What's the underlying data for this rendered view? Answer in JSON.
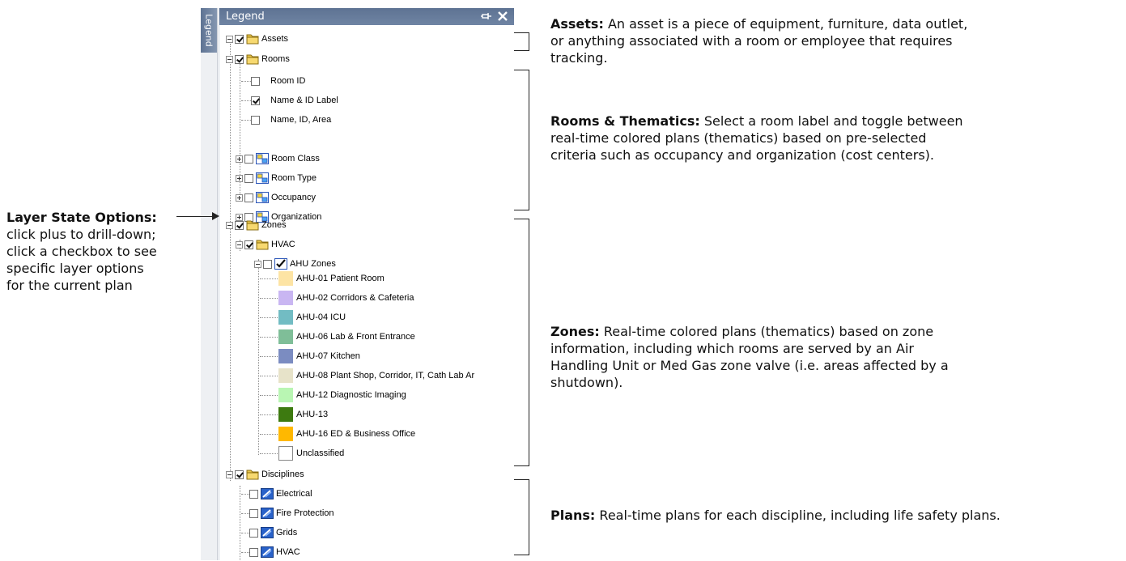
{
  "panel": {
    "side_tab_label": "Legend",
    "title": "Legend",
    "pin_icon": "pin-icon",
    "close_icon": "close-icon"
  },
  "tree": {
    "assets": "Assets",
    "rooms": "Rooms",
    "room_id": "Room ID",
    "name_id_label": "Name & ID Label",
    "name_id_area": "Name, ID, Area",
    "room_class": "Room Class",
    "room_type": "Room Type",
    "occupancy": "Occupancy",
    "organization": "Organization",
    "zones": "Zones",
    "hvac_zone": "HVAC",
    "ahu_zones": "AHU Zones",
    "ahu": [
      {
        "label": "AHU-01 Patient Room",
        "color": "#fde4a4"
      },
      {
        "label": "AHU-02 Corridors & Cafeteria",
        "color": "#c9b6f2"
      },
      {
        "label": "AHU-04 ICU",
        "color": "#72bcc3"
      },
      {
        "label": "AHU-06 Lab & Front Entrance",
        "color": "#7fbe98"
      },
      {
        "label": "AHU-07 Kitchen",
        "color": "#7b8cc1"
      },
      {
        "label": "AHU-08 Plant Shop, Corridor, IT, Cath Lab Ar",
        "color": "#e7e3c9"
      },
      {
        "label": "AHU-12 Diagnostic Imaging",
        "color": "#b9f6b3"
      },
      {
        "label": "AHU-13",
        "color": "#3d7a10"
      },
      {
        "label": "AHU-16 ED & Business Office",
        "color": "#ffb800"
      },
      {
        "label": "Unclassified",
        "color": "#ffffff"
      }
    ],
    "disciplines": "Disciplines",
    "electrical": "Electrical",
    "fire_protection": "Fire Protection",
    "grids": "Grids",
    "hvac_discipline": "HVAC"
  },
  "annotations": {
    "layer_title": "Layer State Options:",
    "layer_l1": "click plus to drill-down;",
    "layer_l2": "click a checkbox to see",
    "layer_l3": "specific layer options",
    "layer_l4": "for the current plan",
    "assets_title": "Assets:",
    "assets_l1": " An asset is a piece of equipment, furniture, data outlet,",
    "assets_l2": "or anything associated with a room or employee that requires",
    "assets_l3": "tracking.",
    "rooms_title": "Rooms & Thematics:",
    "rooms_l1": " Select a room label and toggle between",
    "rooms_l2": "real-time colored plans (thematics) based on pre-selected",
    "rooms_l3": "criteria such as occupancy and organization (cost centers).",
    "zones_title": "Zones:",
    "zones_l1": " Real-time colored plans (thematics) based on zone",
    "zones_l2": "information, including which rooms are served by an Air",
    "zones_l3": "Handling Unit or Med Gas zone valve (i.e. areas affected by a",
    "zones_l4": "shutdown).",
    "plans_title": "Plans:",
    "plans_l1": " Real-time plans for each discipline, including life safety plans."
  }
}
